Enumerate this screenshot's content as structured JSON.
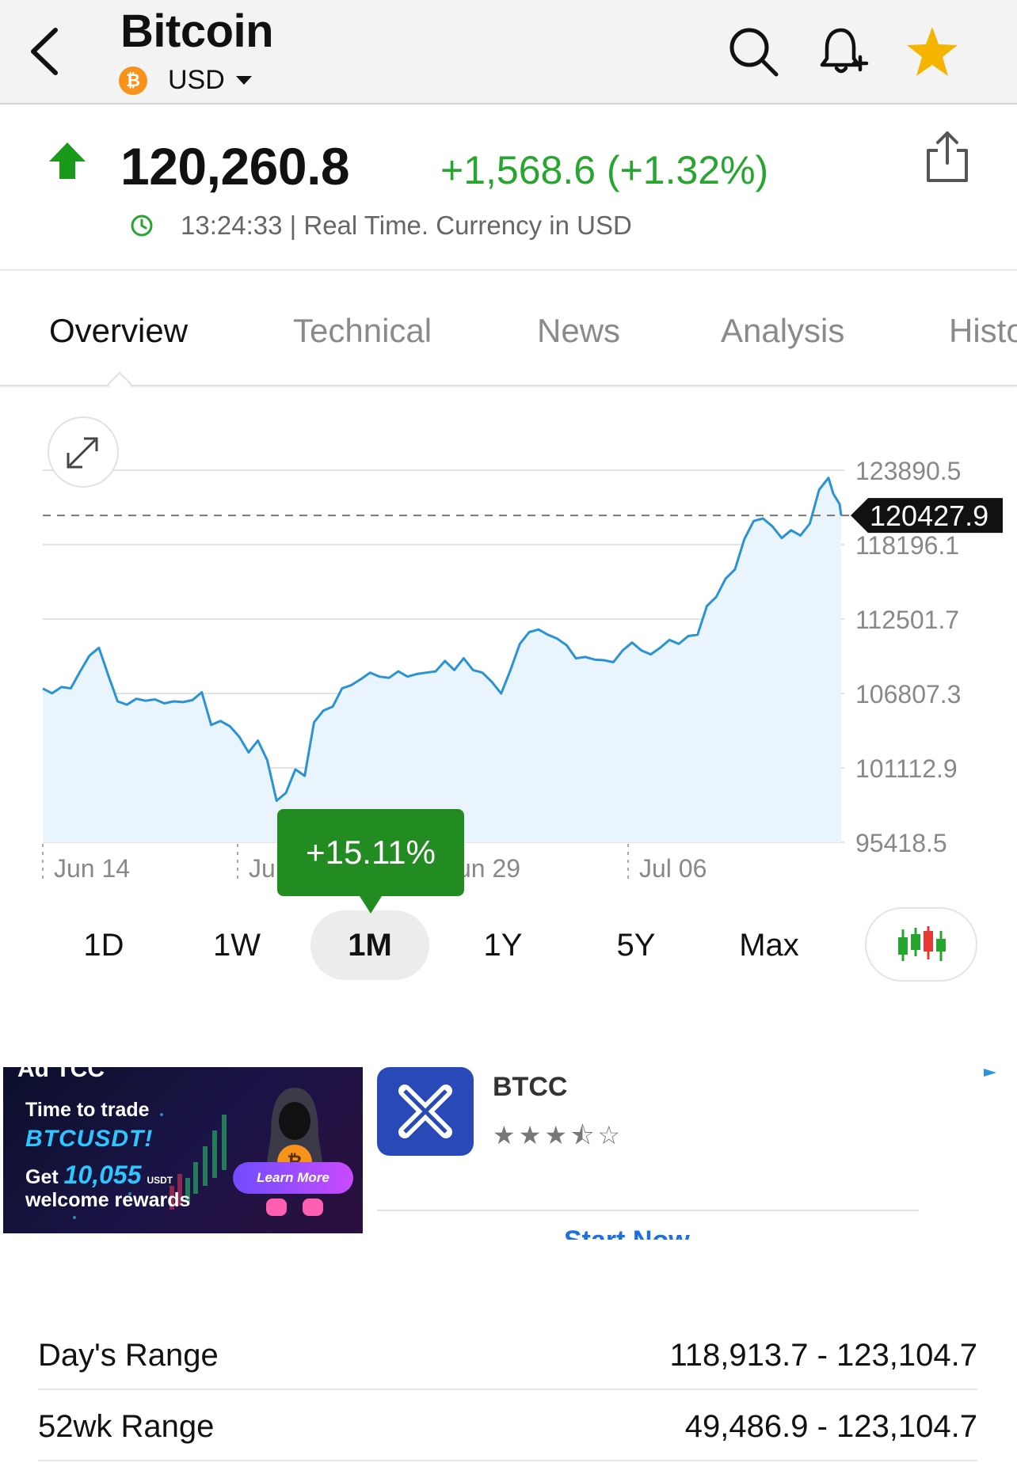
{
  "header": {
    "title": "Bitcoin",
    "currency": "USD",
    "coin_symbol": "₿",
    "icons": [
      "back-chevron-icon",
      "search-icon",
      "bell-plus-icon",
      "star-icon"
    ],
    "star_color": "#f5b400"
  },
  "quote": {
    "price": "120,260.8",
    "change": "+1,568.6 (+1.32%)",
    "timestamp": "13:24:33 | Real Time. Currency in USD",
    "up_color": "#1a9a1a",
    "change_color": "#26a62f"
  },
  "tabs": [
    {
      "label": "Overview",
      "active": true
    },
    {
      "label": "Technical",
      "active": false
    },
    {
      "label": "News",
      "active": false
    },
    {
      "label": "Analysis",
      "active": false
    },
    {
      "label": "Historical",
      "active": false
    }
  ],
  "chart": {
    "period_change": "+15.11%",
    "current_label": "120427.9"
  },
  "chart_data": {
    "type": "area",
    "x": [
      "Jun 14",
      "Jun 21",
      "Jun 29",
      "Jul 06"
    ],
    "y_ticks": [
      "123890.5",
      "118196.1",
      "112501.7",
      "106807.3",
      "101112.9",
      "95418.5"
    ],
    "ylim": [
      95418.5,
      123890.5
    ],
    "current_value": 120427.9,
    "series": [
      {
        "values": [
          107180,
          106820,
          107300,
          107200,
          108500,
          109700,
          110300,
          108200,
          106200,
          105950,
          106400,
          106250,
          106350,
          106050,
          106200,
          106150,
          106300,
          106900,
          104400,
          104700,
          104300,
          103500,
          102300,
          103200,
          101700,
          98600,
          99200,
          101000,
          100500,
          104600,
          105500,
          105800,
          107200,
          107450,
          107900,
          108400,
          108100,
          108000,
          108500,
          108100,
          108300,
          108400,
          108500,
          109300,
          108600,
          109500,
          108600,
          108400,
          107700,
          106800,
          108600,
          110600,
          111500,
          111700,
          111300,
          111000,
          110500,
          109500,
          109600,
          109400,
          109350,
          109200,
          110100,
          110700,
          110100,
          109800,
          110300,
          110900,
          110600,
          111200,
          111300,
          113500,
          114200,
          115600,
          116300,
          118600,
          120000,
          120200,
          119600,
          118700,
          119300,
          118900,
          119800,
          122400,
          123300
        ]
      }
    ],
    "grid": true,
    "line_color": "#2a93d5",
    "fill_color": "#eaf4fc"
  },
  "ranges": [
    {
      "label": "1D",
      "active": false
    },
    {
      "label": "1W",
      "active": false
    },
    {
      "label": "1M",
      "active": true
    },
    {
      "label": "1Y",
      "active": false
    },
    {
      "label": "5Y",
      "active": false
    },
    {
      "label": "Max",
      "active": false
    }
  ],
  "ad": {
    "label": "Ad TCC",
    "line1": "Time to trade",
    "line2": "BTCUSDT!",
    "line3_pre": "Get ",
    "line3_amount": "10,055",
    "line3_unit": "USDT",
    "line4": "welcome rewards",
    "learn": "Learn More",
    "app_name": "BTCC",
    "rating_stars": "★★★⯪☆",
    "cta": "Start Now"
  },
  "stats": [
    {
      "label": "Day's Range",
      "value": "118,913.7 - 123,104.7"
    },
    {
      "label": "52wk Range",
      "value": "49,486.9 - 123,104.7"
    }
  ]
}
